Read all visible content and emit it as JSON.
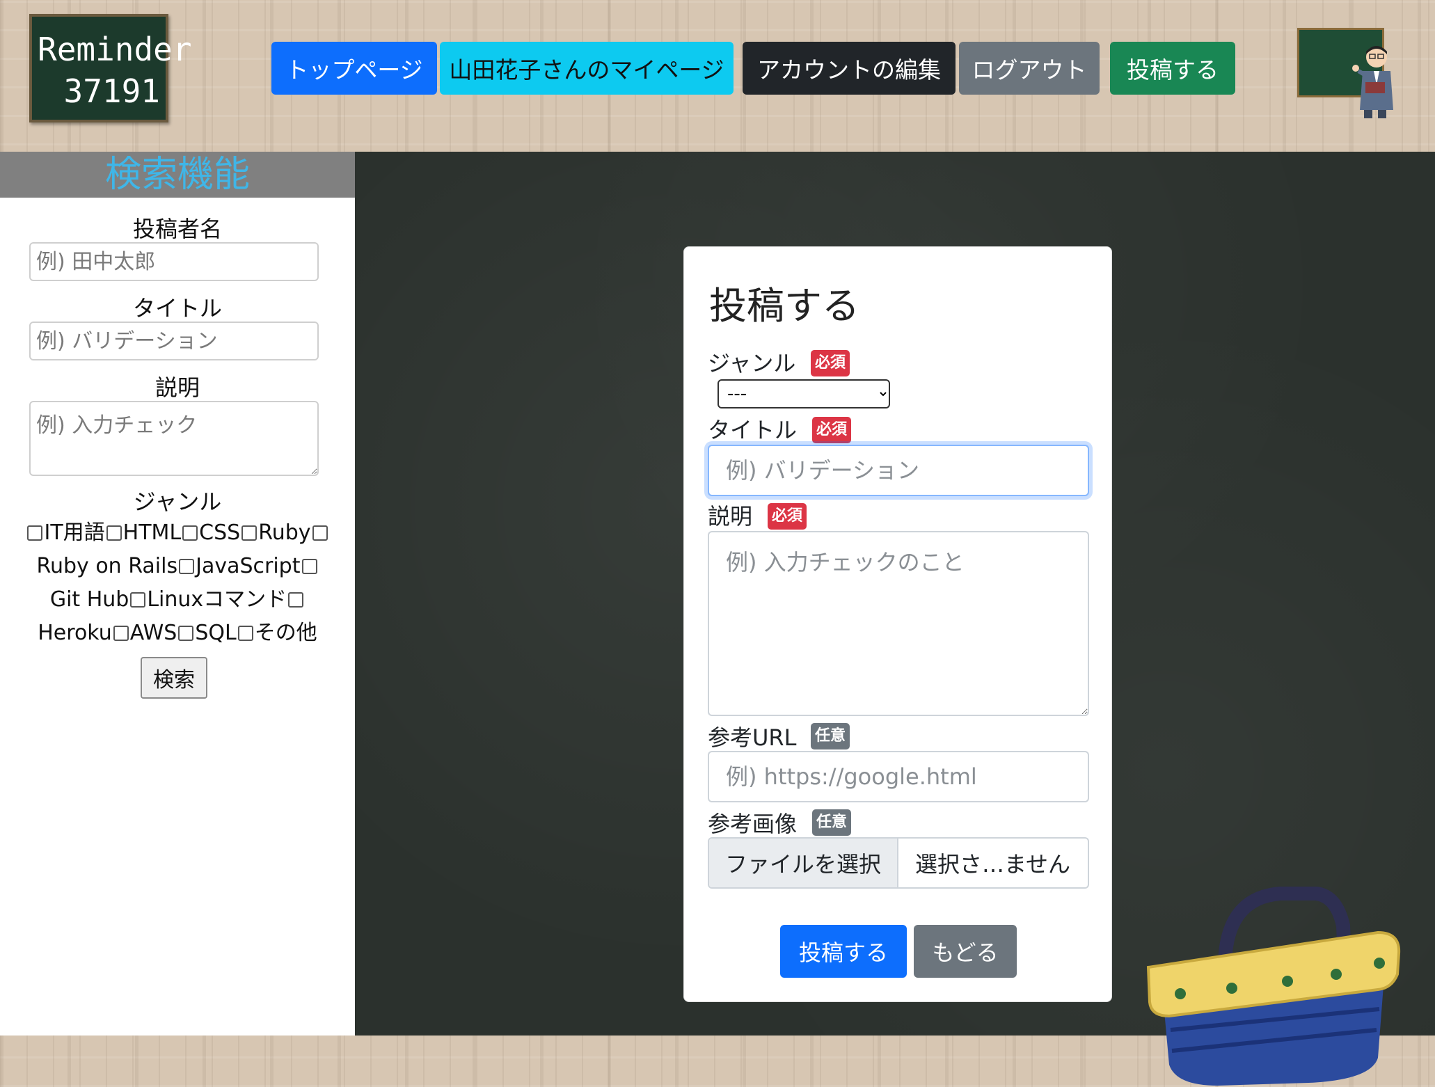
{
  "header": {
    "logo_line1": "Reminder",
    "logo_line2": "37191",
    "nav": {
      "top": "トップページ",
      "mypage": "山田花子さんのマイページ",
      "edit_account": "アカウントの編集",
      "logout": "ログアウト",
      "post": "投稿する"
    }
  },
  "sidebar": {
    "title": "検索機能",
    "author_label": "投稿者名",
    "author_placeholder": "例) 田中太郎",
    "title_label": "タイトル",
    "title_placeholder": "例) バリデーション",
    "desc_label": "説明",
    "desc_placeholder": "例) 入力チェック",
    "genre_label": "ジャンル",
    "genres": [
      "IT用語",
      "HTML",
      "CSS",
      "Ruby",
      "Ruby on Rails",
      "JavaScript",
      "Git Hub",
      "Linuxコマンド",
      "Heroku",
      "AWS",
      "SQL",
      "その他"
    ],
    "search_button": "検索"
  },
  "form": {
    "heading": "投稿する",
    "genre_label": "ジャンル",
    "genre_selected": "---",
    "title_label": "タイトル",
    "title_placeholder": "例) バリデーション",
    "desc_label": "説明",
    "desc_placeholder": "例) 入力チェックのこと",
    "url_label": "参考URL",
    "url_placeholder": "例) https://google.html",
    "image_label": "参考画像",
    "file_button": "ファイルを選択",
    "file_status": "選択さ…ません",
    "required_badge": "必須",
    "optional_badge": "任意",
    "submit_button": "投稿する",
    "back_button": "もどる"
  },
  "colors": {
    "primary": "#0d6efd",
    "info": "#0dcaf0",
    "dark": "#212529",
    "secondary": "#6c757d",
    "success": "#198754",
    "danger": "#dc3545",
    "sidebar_title": "#3fb6e8",
    "chalkboard": "#2b312d"
  }
}
